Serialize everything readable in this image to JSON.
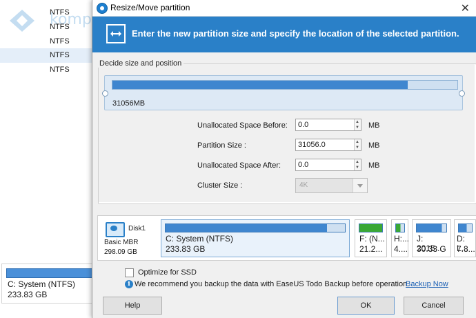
{
  "background": {
    "rows": [
      "NTFS",
      "NTFS",
      "NTFS",
      "NTFS",
      "NTFS"
    ],
    "watermark": "kompiwin",
    "partition_card": {
      "name": "C: System (NTFS)",
      "size": "233.83 GB"
    }
  },
  "dialog": {
    "title": "Resize/Move partition",
    "close_glyph": "✕",
    "banner_text": "Enter the new partition size and specify the location of the selected partition.",
    "group_label": "Decide size and position",
    "partition_size_text": "31056MB",
    "partition_fill_fraction": 0.855,
    "fields": {
      "unalloc_before": {
        "label": "Unallocated Space Before:",
        "value": "0.0",
        "unit": "MB"
      },
      "partition_size": {
        "label": "Partition Size :",
        "value": "31056.0",
        "unit": "MB"
      },
      "unalloc_after": {
        "label": "Unallocated Space After:",
        "value": "0.0",
        "unit": "MB"
      },
      "cluster_size": {
        "label": "Cluster Size :",
        "value": "4K"
      }
    },
    "disk": {
      "name": "Disk1",
      "type": "Basic MBR",
      "size": "298.09 GB",
      "partitions": [
        {
          "line1": "C: System (NTFS)",
          "line2": "233.83 GB",
          "fill": 0.9,
          "color": "#3f86cf"
        },
        {
          "line1": "F: (N...",
          "line2": "21.2...",
          "fill": 1.0,
          "color": "#3aa835"
        },
        {
          "line1": "H:...",
          "line2": "4....",
          "fill": 0.55,
          "color": "#3aa835"
        },
        {
          "line1": "J: 2015...",
          "line2": "30.33 G",
          "fill": 0.85,
          "color": "#3f86cf"
        },
        {
          "line1": "D: L...",
          "line2": "7.8...",
          "fill": 0.6,
          "color": "#3f86cf"
        }
      ]
    },
    "optimize_label": "Optimize for SSD",
    "info_text": "We recommend you backup the data with EaseUS Todo Backup before operation.",
    "backup_link": "Backup Now",
    "buttons": {
      "help": "Help",
      "ok": "OK",
      "cancel": "Cancel"
    }
  }
}
